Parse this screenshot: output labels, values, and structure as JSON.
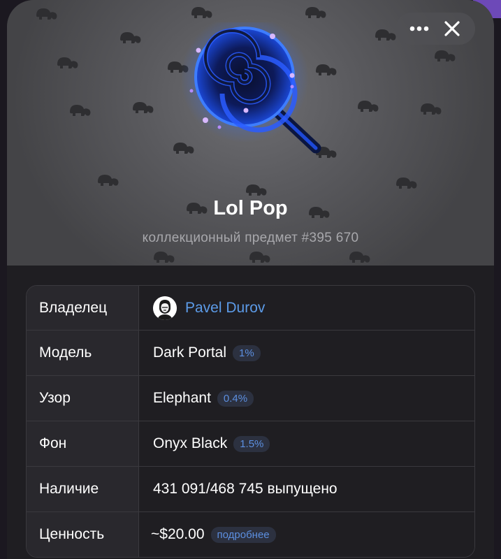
{
  "hero": {
    "title": "Lol Pop",
    "subtitle": "коллекционный предмет #395 670",
    "icon": "lollipop-icon"
  },
  "controls": {
    "more_icon": "more-dots-icon",
    "close_icon": "close-icon"
  },
  "table": {
    "owner": {
      "label": "Владелец",
      "value": "Pavel Durov",
      "icon": "avatar"
    },
    "model": {
      "label": "Модель",
      "value": "Dark Portal",
      "badge": "1%"
    },
    "pattern": {
      "label": "Узор",
      "value": "Elephant",
      "badge": "0.4%"
    },
    "backdrop": {
      "label": "Фон",
      "value": "Onyx Black",
      "badge": "1.5%"
    },
    "availability": {
      "label": "Наличие",
      "value": "431 091/468 745 выпущено"
    },
    "value": {
      "label": "Ценность",
      "value": "~$20.00",
      "badge": "подробнее"
    }
  },
  "colors": {
    "accent_link": "#5c9be8",
    "badge_text": "#5c8fe0",
    "badge_bg": "#2c3140",
    "lollipop_glow": "#2f6bff"
  }
}
